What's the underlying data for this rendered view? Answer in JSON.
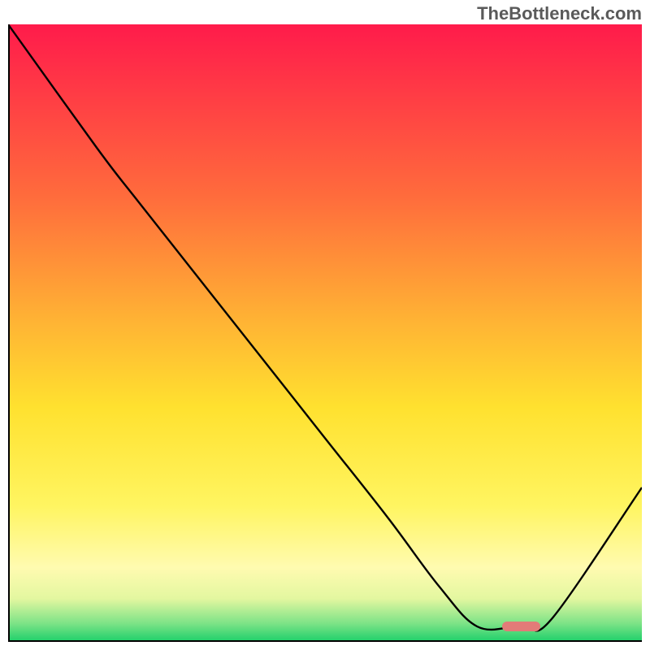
{
  "watermark": "TheBottleneck.com",
  "chart_data": {
    "type": "line",
    "title": "",
    "xlabel": "",
    "ylabel": "",
    "xlim": [
      0,
      100
    ],
    "ylim": [
      0,
      100
    ],
    "grid": false,
    "series": [
      {
        "name": "curve",
        "x": [
          0,
          14,
          20,
          30,
          40,
          50,
          60,
          68,
          74,
          80,
          82,
          86,
          100
        ],
        "values": [
          100,
          80,
          72,
          59,
          46,
          33,
          20,
          9,
          2.5,
          2.5,
          2.5,
          4,
          25
        ]
      }
    ],
    "marker": {
      "x_start": 78,
      "x_end": 84,
      "y": 2.5
    },
    "background_gradient": {
      "stops": [
        {
          "offset": 0,
          "color": "#ff1b4b"
        },
        {
          "offset": 28,
          "color": "#ff6c3c"
        },
        {
          "offset": 48,
          "color": "#ffb334"
        },
        {
          "offset": 62,
          "color": "#ffe12f"
        },
        {
          "offset": 78,
          "color": "#fff561"
        },
        {
          "offset": 88,
          "color": "#fffbb0"
        },
        {
          "offset": 93,
          "color": "#e3f7a0"
        },
        {
          "offset": 97,
          "color": "#7de387"
        },
        {
          "offset": 100,
          "color": "#1ccf6a"
        }
      ]
    }
  }
}
